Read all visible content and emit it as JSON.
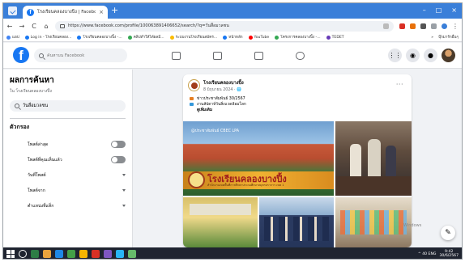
{
  "browser": {
    "tab_title": "โรงเรียนคลองบางปิ้ง | Facebook",
    "tab_close": "×",
    "new_tab": "+",
    "win_controls": [
      "–",
      "□",
      "×"
    ],
    "url": "https://www.facebook.com/profile/100063891406652/search/?q=วันสื่อมวลชน",
    "nav": [
      "←",
      "→",
      "C",
      "⌂"
    ],
    "bookmarks": [
      {
        "label": "แอป",
        "color": "#4285f4"
      },
      {
        "label": "Log in - โรงเรียนคลอง...",
        "color": "#1877f2"
      },
      {
        "label": "โรงเรียนคลองบางปิ้ง -...",
        "color": "#1877f2"
      },
      {
        "label": "คลิปทำให้ได้ผลมี...",
        "color": "#34a853"
      },
      {
        "label": "ระบบงานโรงเรียนสมัคร...",
        "color": "#fbbc05"
      },
      {
        "label": "หน้าหลัก",
        "color": "#1877f2"
      },
      {
        "label": "YouTube",
        "color": "#ff0000"
      },
      {
        "label": "โครงการคลองบางปิ้ง -...",
        "color": "#34a853"
      },
      {
        "label": "TEDET",
        "color": "#673ab7"
      }
    ],
    "bookmarks_right": [
      "»",
      "บุ๊กมาร์กอื่นๆ"
    ]
  },
  "facebook": {
    "logo": "f",
    "search_placeholder": "ค้นหาบน Facebook",
    "right_icons": [
      "⋮⋮",
      "◉",
      "●"
    ]
  },
  "sidebar": {
    "title": "ผลการค้นหา",
    "subtitle": "ใน โรงเรียนคลองบางปิ้ง",
    "query": "วันสื่อมวลชน",
    "filters_heading": "ตัวกรอง",
    "filters": [
      {
        "label": "โพสต์ล่าสุด",
        "control": "toggle"
      },
      {
        "label": "โพสต์ที่คุณเห็นแล้ว",
        "control": "toggle"
      },
      {
        "label": "วันที่โพสต์",
        "control": "dropdown"
      },
      {
        "label": "โพสต์จาก",
        "control": "dropdown"
      },
      {
        "label": "ตำแหน่งที่แท็ก",
        "control": "dropdown"
      }
    ]
  },
  "post": {
    "author": "โรงเรียนคลองบางปิ้ง",
    "date": "8 มิถุนายน 2024 · 🌐",
    "more": "···",
    "lines": [
      {
        "text": "ข่าวประชาสัมพันธ์ 30/2567",
        "color": "#e67e22"
      },
      {
        "text": "งานสัปดาห์วันสิ่งแวดล้อมโลก",
        "color": "#3498db"
      },
      {
        "text": "ดูเพิ่มเติม",
        "color": "#ffffff"
      }
    ],
    "photo_watermark": "@ประชาสัมพันธ์ CBEC LPA",
    "photo_banner": "โรงเรียนคลองบางปิ้ง",
    "photo_banner_sub": "สำนักงานเขตพื้นที่การศึกษาประถมศึกษาสมุทรปราการ เขต 1"
  },
  "overlay": {
    "activate_line1": "Windows",
    "activate_line2": "Windows",
    "compose_icon": "✎"
  },
  "taskbar": {
    "icons": [
      "#2d7d46",
      "#e8a33d",
      "#1e88e5",
      "#43a047",
      "#f4b400",
      "#d93025",
      "#7e57c2",
      "#29b6f6",
      "#66bb6a"
    ],
    "tray_text": "^ 40 ENG",
    "time": "9:42",
    "date": "30/6/2567"
  }
}
